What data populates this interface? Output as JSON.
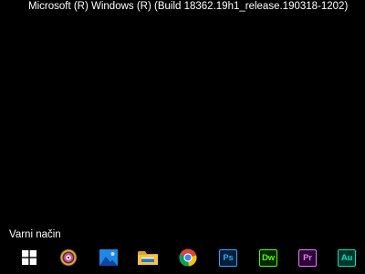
{
  "desktop": {
    "build_text": "Microsoft (R) Windows (R) (Build 18362.19h1_release.190318-1202)",
    "safe_mode_text": "Varni način"
  },
  "taskbar": {
    "items": [
      {
        "name": "start",
        "icon": "windows-logo-icon"
      },
      {
        "name": "media-player",
        "icon": "groove-music-icon"
      },
      {
        "name": "photos",
        "icon": "photos-icon"
      },
      {
        "name": "file-explorer",
        "icon": "folder-icon"
      },
      {
        "name": "chrome",
        "icon": "chrome-icon"
      },
      {
        "name": "photoshop",
        "icon": "photoshop-icon",
        "label": "Ps",
        "color": "#31a8ff",
        "bg": "#001e36"
      },
      {
        "name": "dreamweaver",
        "icon": "dreamweaver-icon",
        "label": "Dw",
        "color": "#4cff00",
        "bg": "#072401"
      },
      {
        "name": "premiere",
        "icon": "premiere-icon",
        "label": "Pr",
        "color": "#ea77ff",
        "bg": "#2a0634"
      },
      {
        "name": "audition",
        "icon": "audition-icon",
        "label": "Au",
        "color": "#00e4bb",
        "bg": "#00332a"
      }
    ]
  }
}
